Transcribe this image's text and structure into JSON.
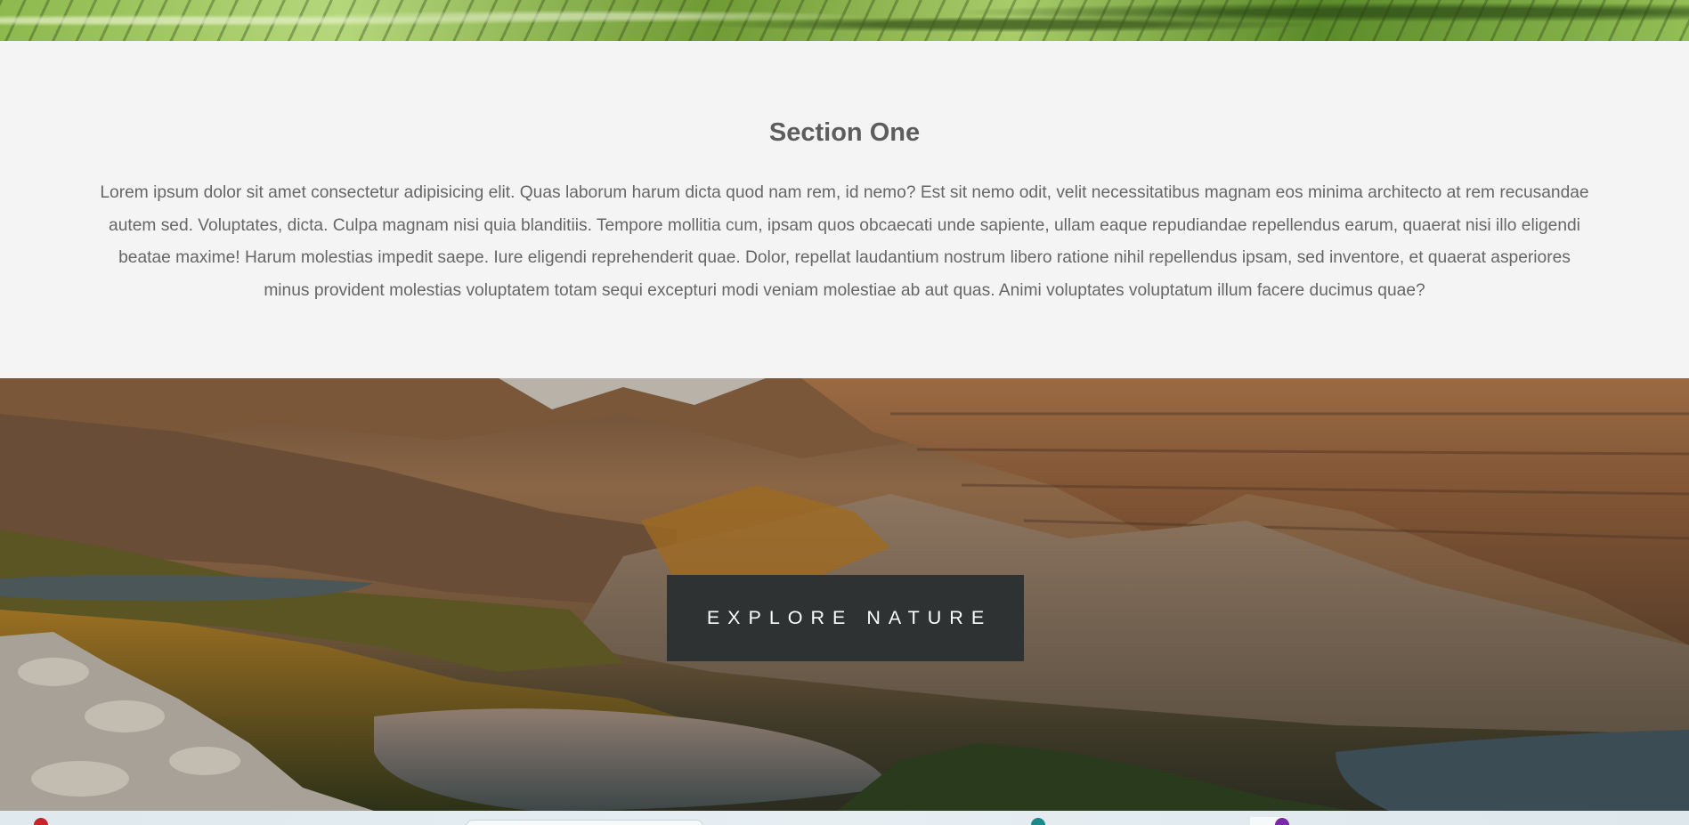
{
  "section_one": {
    "title": "Section One",
    "body": "Lorem ipsum dolor sit amet consectetur adipisicing elit. Quas laborum harum dicta quod nam rem, id nemo? Est sit nemo odit, velit necessitatibus magnam eos minima architecto at rem recusandae autem sed. Voluptates, dicta. Culpa magnam nisi quia blanditiis. Tempore mollitia cum, ipsam quos obcaecati unde sapiente, ullam eaque repudiandae repellendus earum, quaerat nisi illo eligendi beatae maxime! Harum molestias impedit saepe. Iure eligendi reprehenderit quae. Dolor, repellat laudantium nostrum libero ratione nihil repellendus ipsam, sed inventore, et quaerat asperiores minus provident molestias voluptatem totam sequi excepturi modi veniam molestiae ab aut quas. Animi voluptates voluptatum illum facere ducimus quae?"
  },
  "cta": {
    "label": "EXPLORE NATURE"
  },
  "colors": {
    "section_bg": "#f4f4f4",
    "title": "#5d5d5d",
    "body_text": "#666666",
    "button_bg": "#2f3233",
    "button_text": "#ffffff"
  },
  "icons": {
    "taskbar_left": "app-icon",
    "taskbar_center": "app-icon",
    "taskbar_right": "app-icon"
  }
}
